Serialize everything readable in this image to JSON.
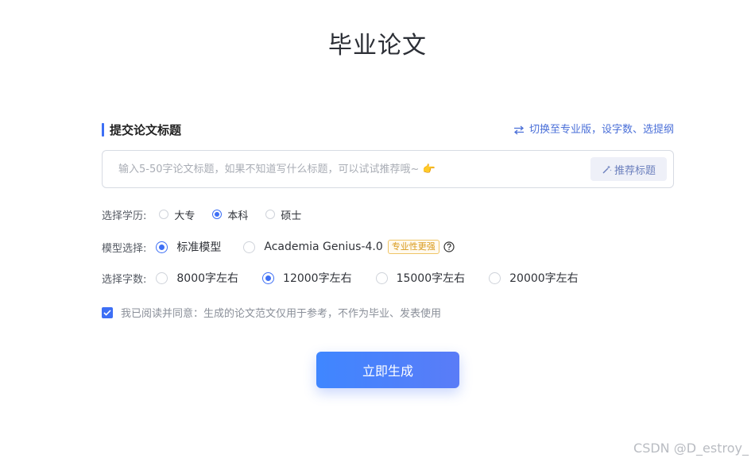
{
  "page": {
    "title": "毕业论文"
  },
  "section": {
    "title": "提交论文标题",
    "switch_link": "切换至专业版，设字数、选提纲"
  },
  "title_input": {
    "placeholder": "输入5-50字论文标题，如果不知道写什么标题，可以试试推荐哦~ 👉",
    "value": "",
    "recommend_button": "推荐标题"
  },
  "education": {
    "label": "选择学历:",
    "options": [
      "大专",
      "本科",
      "硕士"
    ],
    "selected": "本科"
  },
  "model": {
    "label": "模型选择:",
    "options": [
      "标准模型",
      "Academia Genius-4.0"
    ],
    "selected": "标准模型",
    "badge": "专业性更强"
  },
  "word_count": {
    "label": "选择字数:",
    "options": [
      "8000字左右",
      "12000字左右",
      "15000字左右",
      "20000字左右"
    ],
    "selected": "12000字左右"
  },
  "agreement": {
    "checked": true,
    "text": "我已阅读并同意：生成的论文范文仅用于参考，不作为毕业、发表使用"
  },
  "generate_button": "立即生成",
  "watermark": "CSDN @D_estroy_",
  "colors": {
    "accent": "#3d6ff5",
    "link": "#4a6fd8",
    "badge": "#d99a1c"
  }
}
